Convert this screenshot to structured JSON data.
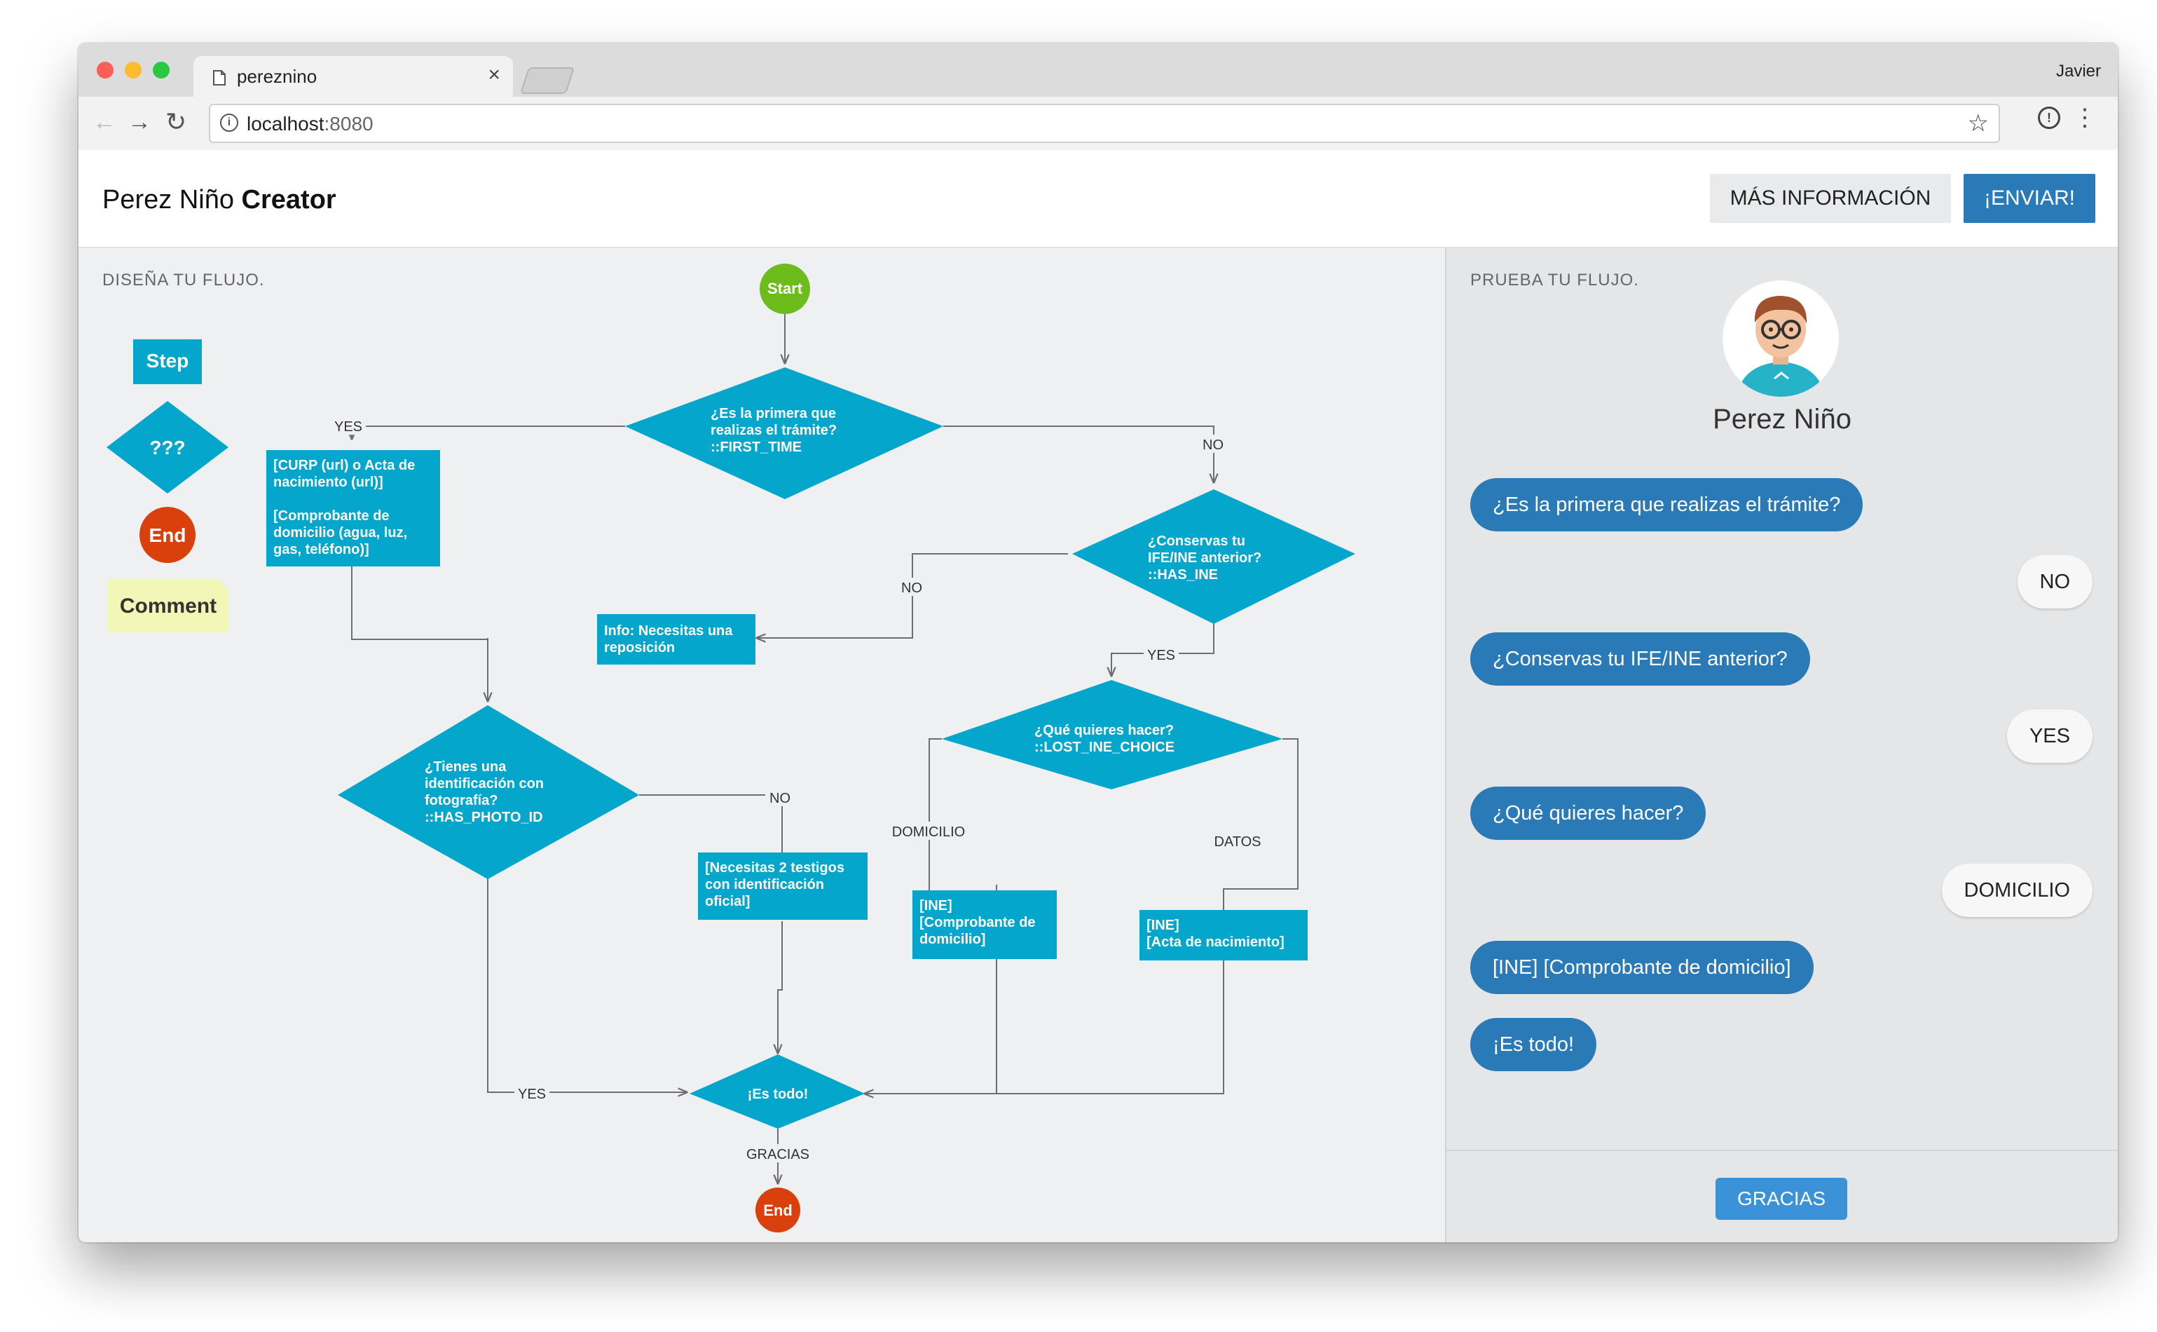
{
  "browser": {
    "tab_title": "pereznino",
    "tab_close": "×",
    "user": "Javier",
    "url_host": "localhost",
    "url_port": ":8080"
  },
  "header": {
    "brand_light": "Perez Niño",
    "brand_bold": "Creator",
    "more_info_button": "MÁS INFORMACIÓN",
    "send_button": "¡ENVIAR!"
  },
  "designer": {
    "title": "DISEÑA TU FLUJO.",
    "palette": {
      "step": "Step",
      "decision": "???",
      "end": "End",
      "comment": "Comment"
    },
    "nodes": [
      {
        "id": "start",
        "kind": "start",
        "lines": [
          "Start"
        ]
      },
      {
        "id": "first_time",
        "kind": "decision",
        "lines": [
          "¿Es la primera que",
          "realizas el trámite?",
          "::FIRST_TIME"
        ]
      },
      {
        "id": "curp",
        "kind": "step",
        "lines": [
          "[CURP (url) o Acta de",
          "nacimiento (url)]",
          "",
          "[Comprobante de",
          "domicilio (agua, luz,",
          "gas, teléfono)]"
        ]
      },
      {
        "id": "has_ine",
        "kind": "decision",
        "lines": [
          "¿Conservas tu",
          "IFE/INE anterior?",
          "::HAS_INE"
        ]
      },
      {
        "id": "info_repo",
        "kind": "step",
        "lines": [
          "Info: Necesitas una",
          "reposición"
        ]
      },
      {
        "id": "lost_choice",
        "kind": "decision",
        "lines": [
          "¿Qué quieres hacer?",
          "::LOST_INE_CHOICE"
        ]
      },
      {
        "id": "photo_id",
        "kind": "decision",
        "lines": [
          "¿Tienes una",
          "identificación con",
          "fotografía?",
          "::HAS_PHOTO_ID"
        ]
      },
      {
        "id": "testigos",
        "kind": "step",
        "lines": [
          "[Necesitas 2 testigos",
          "con identificación",
          "oficial]"
        ]
      },
      {
        "id": "ine_dom",
        "kind": "step",
        "lines": [
          "[INE]",
          "[Comprobante de",
          "domicilio]"
        ]
      },
      {
        "id": "ine_acta",
        "kind": "step",
        "lines": [
          "[INE]",
          "[Acta de nacimiento]"
        ]
      },
      {
        "id": "es_todo",
        "kind": "decision",
        "lines": [
          "¡Es todo!"
        ]
      },
      {
        "id": "end",
        "kind": "end",
        "lines": [
          "End"
        ]
      }
    ],
    "edge_labels": {
      "yes_curp": "YES",
      "no_ine": "NO",
      "no_info": "NO",
      "yes_choice": "YES",
      "domicilio": "DOMICILIO",
      "datos": "DATOS",
      "no_testigos": "NO",
      "yes_todo": "YES",
      "gracias": "GRACIAS"
    }
  },
  "tester": {
    "title": "PRUEBA TU FLUJO.",
    "bot_name": "Perez Niño",
    "messages": [
      {
        "from": "bot",
        "text": "¿Es la primera que realizas el trámite?"
      },
      {
        "from": "user",
        "text": "NO"
      },
      {
        "from": "bot",
        "text": "¿Conservas tu IFE/INE anterior?"
      },
      {
        "from": "user",
        "text": "YES"
      },
      {
        "from": "bot",
        "text": "¿Qué quieres hacer?"
      },
      {
        "from": "user",
        "text": "DOMICILIO"
      },
      {
        "from": "bot",
        "text": "[INE] [Comprobante de domicilio]"
      },
      {
        "from": "bot",
        "text": "¡Es todo!"
      }
    ],
    "reply_button": "GRACIAS"
  },
  "colors": {
    "node": "#04a6cc",
    "start": "#6cbc1c",
    "end": "#d9400b",
    "comment": "#f2f7b5",
    "edge": "#6e6e6e",
    "accent": "#2a7ab8"
  }
}
